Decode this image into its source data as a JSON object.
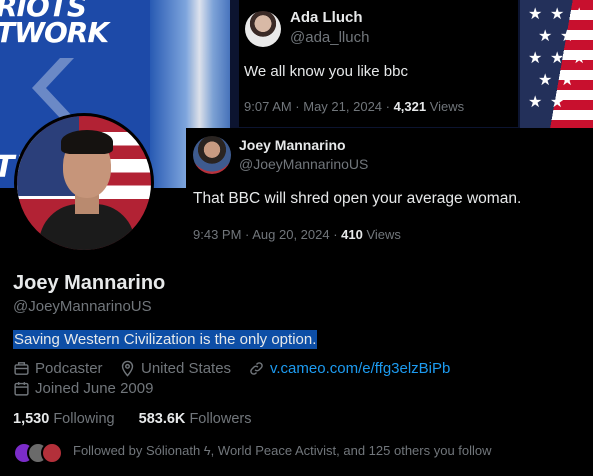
{
  "banner": {
    "wall_text_top": "RIOTS\nTWORK",
    "wall_text_bottom": "TR"
  },
  "quoted_tweet_1": {
    "name": "Ada Lluch",
    "handle": "@ada_lluch",
    "text": "We all know you like bbc",
    "time": "9:07 AM · May 21, 2024 · ",
    "views_count": "4,321",
    "views_label": " Views"
  },
  "quoted_tweet_2": {
    "name": "Joey Mannarino",
    "handle": "@JoeyMannarinoUS",
    "text": "That BBC will shred open your average woman.",
    "time": "9:43 PM · Aug 20, 2024 · ",
    "views_count": "410",
    "views_label": " Views"
  },
  "profile": {
    "display_name": "Joey Mannarino",
    "handle": "@JoeyMannarinoUS",
    "bio": "Saving Western Civilization is the only option.",
    "category": "Podcaster",
    "location": "United States",
    "link": "v.cameo.com/e/ffg3elzBiPb",
    "joined": "Joined June 2009",
    "following_count": "1,530",
    "following_label": "Following",
    "followers_count": "583.6K",
    "followers_label": "Followers",
    "followed_by": "Followed by Sólionath ϟ, World Peace Activist, and 125 others you follow"
  },
  "colors": {
    "background": "#000000",
    "primary_text": "#e7e9ea",
    "secondary_text": "#71767b",
    "link": "#1d9bf0",
    "bio_highlight": "#0d4ea6"
  },
  "icons": {
    "category": "briefcase-icon",
    "location": "location-pin-icon",
    "link": "link-icon",
    "joined": "calendar-icon"
  }
}
